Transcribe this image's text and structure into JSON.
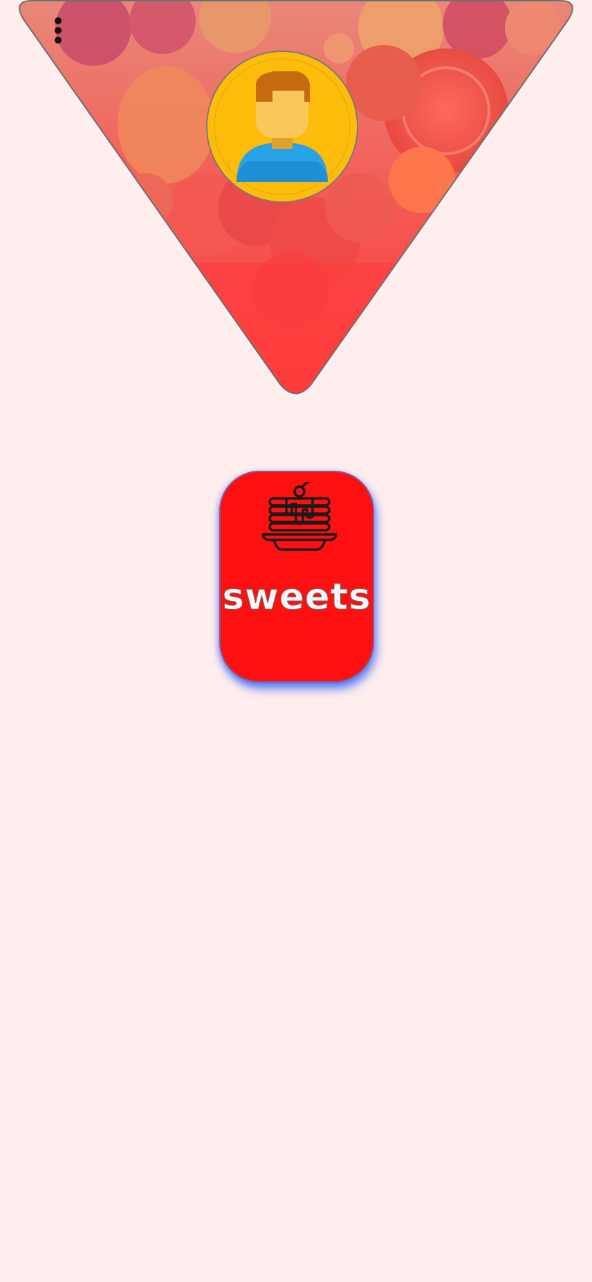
{
  "header": {
    "menu_icon": "more-vert-icon",
    "avatar_icon": "user-avatar-icon",
    "background_image": "fruit-background"
  },
  "category": {
    "label": "sweets",
    "icon": "pancake-stack-icon"
  },
  "colors": {
    "page_background": "#ffeeee",
    "card_background": "#ff1010",
    "card_glow": "#2a5aff",
    "avatar_ring": "#fdbc0a",
    "label_text": "#f7f7f7"
  }
}
